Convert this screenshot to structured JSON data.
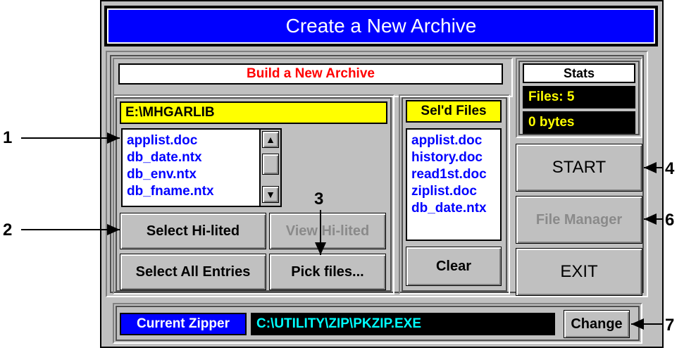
{
  "window": {
    "title": "Create a New Archive"
  },
  "header": {
    "build_label": "Build a New Archive"
  },
  "stats": {
    "title": "Stats",
    "files": "Files: 5",
    "bytes": "0 bytes"
  },
  "browser": {
    "path": "E:\\MHGARLIB",
    "files": [
      "applist.doc",
      "db_date.ntx",
      "db_env.ntx",
      "db_fname.ntx"
    ]
  },
  "selected": {
    "title": "Sel'd Files",
    "files": [
      "applist.doc",
      "history.doc",
      "read1st.doc",
      "ziplist.doc",
      "db_date.ntx"
    ],
    "clear_label": "Clear"
  },
  "buttons": {
    "select_hilited": "Select Hi-lited",
    "view_hilited": "View Hi-lited",
    "select_all": "Select All Entries",
    "pick_files": "Pick files...",
    "start": "START",
    "file_manager": "File Manager",
    "exit": "EXIT",
    "change": "Change"
  },
  "zipper": {
    "label": "Current Zipper",
    "path": "C:\\UTILITY\\ZIP\\PKZIP.EXE"
  },
  "annotations": [
    "1",
    "2",
    "3",
    "4",
    "6",
    "7"
  ],
  "colors": {
    "title_bar": "#0000ff",
    "path_bg": "#ffff00",
    "stats_bg": "#000000",
    "stats_text": "#ffff00",
    "zipper_path_text": "#00ffff",
    "header_text": "#ff0000"
  }
}
